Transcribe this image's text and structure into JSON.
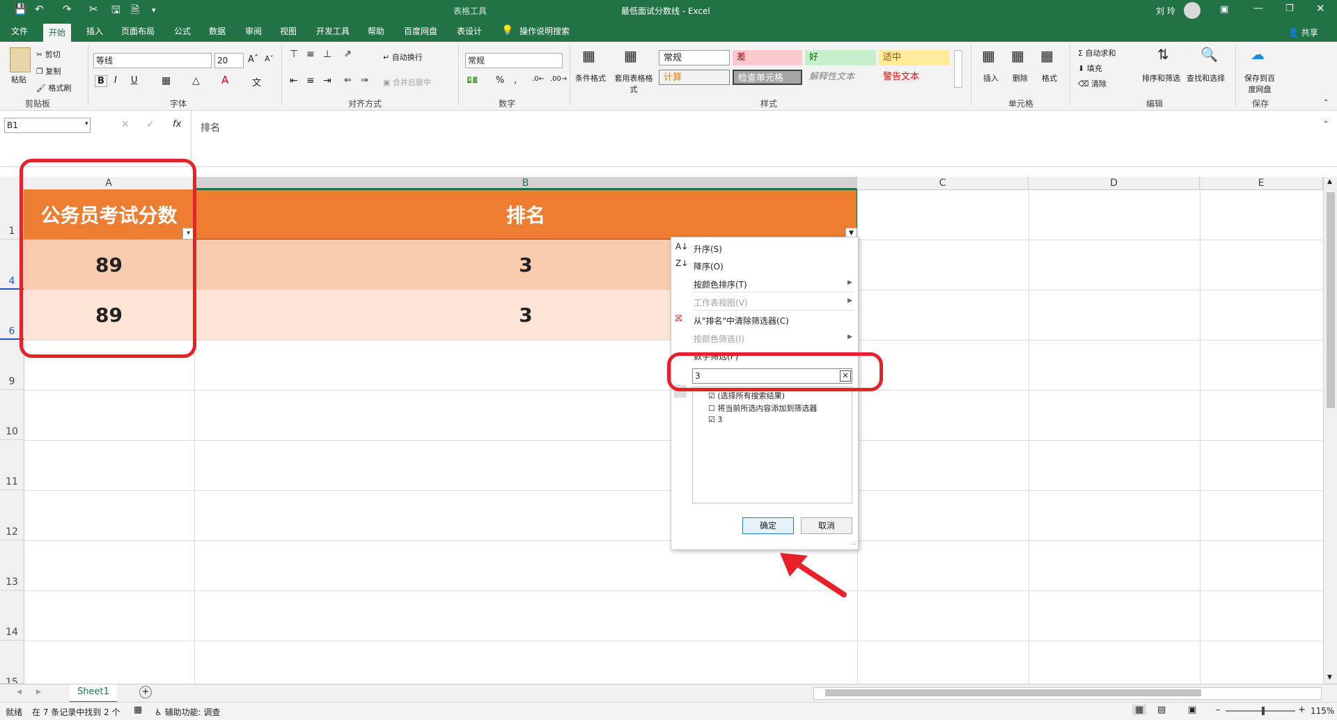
{
  "titlebar": {
    "context_tool": "表格工具",
    "doc_title": "最低面试分数线 - Excel",
    "user": "刘 玲",
    "share": "共享"
  },
  "tabs": [
    "文件",
    "开始",
    "插入",
    "页面布局",
    "公式",
    "数据",
    "审阅",
    "视图",
    "开发工具",
    "帮助",
    "百度网盘",
    "表设计"
  ],
  "tell_me": "操作说明搜索",
  "ribbon": {
    "clipboard": {
      "paste": "粘贴",
      "cut": "剪切",
      "copy": "复制",
      "format_painter": "格式刷",
      "label": "剪贴板"
    },
    "font": {
      "name": "等线",
      "size": "20",
      "label": "字体"
    },
    "alignment": {
      "wrap": "自动换行",
      "merge": "合并后居中",
      "label": "对齐方式"
    },
    "number": {
      "format": "常规",
      "label": "数字"
    },
    "styles": {
      "conditional": "条件格式",
      "table_format": "套用表格格式",
      "normal": "常规",
      "bad": "差",
      "good": "好",
      "neutral": "适中",
      "calc": "计算",
      "check": "检查单元格",
      "explain": "解释性文本",
      "warn": "警告文本",
      "label": "样式"
    },
    "cells": {
      "insert": "插入",
      "delete": "删除",
      "format": "格式",
      "label": "单元格"
    },
    "editing": {
      "autosum": "自动求和",
      "fill": "填充",
      "clear": "清除",
      "sort_filter": "排序和筛选",
      "find": "查找和选择",
      "label": "编辑"
    },
    "save": {
      "save_to": "保存到百度网盘",
      "label": "保存"
    }
  },
  "formula": {
    "namebox": "B1",
    "content": "排名"
  },
  "columns": [
    "A",
    "B",
    "C",
    "D",
    "E"
  ],
  "rows": [
    "1",
    "4",
    "6",
    "9",
    "10",
    "11",
    "12",
    "13",
    "14",
    "15"
  ],
  "table": {
    "header": [
      "公务员考试分数",
      "排名"
    ],
    "data": [
      [
        "89",
        "3"
      ],
      [
        "89",
        "3"
      ]
    ]
  },
  "filter_menu": {
    "sort_asc": "升序(S)",
    "sort_desc": "降序(O)",
    "sort_color": "按颜色排序(T)",
    "sheet_view": "工作表视图(V)",
    "clear_filter": "从\"排名\"中清除筛选器(C)",
    "filter_color": "按颜色筛选(I)",
    "number_filter": "数字筛选(F)",
    "search_value": "3",
    "list": [
      {
        "label": "(选择所有搜索结果)",
        "checked": true
      },
      {
        "label": "将当前所选内容添加到筛选器",
        "checked": false
      },
      {
        "label": "3",
        "checked": true
      }
    ],
    "ok": "确定",
    "cancel": "取消"
  },
  "sheet_tabs": [
    "Sheet1"
  ],
  "status": {
    "ready": "就绪",
    "found": "在 7 条记录中找到 2 个",
    "accessibility": "辅助功能: 调查",
    "zoom": "115%"
  },
  "colors": {
    "excel_green": "#217346",
    "header_orange": "#ed7d31",
    "row1": "#f8cbad",
    "row2": "#fce4d6",
    "annotation_red": "#e8202a"
  }
}
